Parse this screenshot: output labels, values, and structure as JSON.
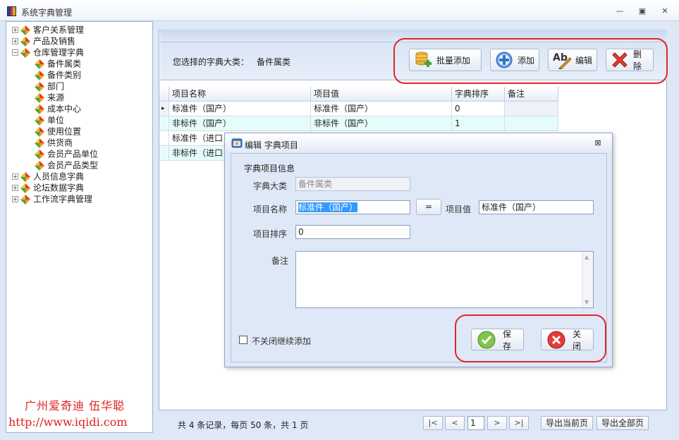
{
  "window": {
    "title": "系统字典管理"
  },
  "tree": {
    "items": [
      {
        "label": "客户关系管理",
        "expander": "⊞"
      },
      {
        "label": "产品及销售",
        "expander": "⊞"
      },
      {
        "label": "仓库管理字典",
        "expander": "⊟"
      },
      {
        "label": "备件属类"
      },
      {
        "label": "备件类别"
      },
      {
        "label": "部门"
      },
      {
        "label": "来源"
      },
      {
        "label": "成本中心"
      },
      {
        "label": "单位"
      },
      {
        "label": "使用位置"
      },
      {
        "label": "供货商"
      },
      {
        "label": "会员产品单位"
      },
      {
        "label": "会员产品类型"
      },
      {
        "label": "人员信息字典",
        "expander": "⊞"
      },
      {
        "label": "论坛数据字典",
        "expander": "⊞"
      },
      {
        "label": "工作流字典管理",
        "expander": "⊞"
      }
    ]
  },
  "watermark": {
    "line1": "广州爱奇迪 伍华聪",
    "line2": "http://www.iqidi.com"
  },
  "header": {
    "category_label": "您选择的字典大类：",
    "category_value": "备件属类"
  },
  "toolbar": {
    "batch_add": "批量添加",
    "add": "添加",
    "edit": "编辑",
    "delete": "删除"
  },
  "grid": {
    "columns": [
      "项目名称",
      "项目值",
      "字典排序",
      "备注"
    ],
    "rows": [
      [
        "标准件（国产）",
        "标准件（国产）",
        "0",
        ""
      ],
      [
        "非标件（国产）",
        "非标件（国产）",
        "1",
        ""
      ],
      [
        "标准件（进口",
        "",
        "",
        ""
      ],
      [
        "非标件（进口",
        "",
        "",
        ""
      ]
    ],
    "row_indicator": "▸"
  },
  "pager": {
    "summary": "共 4 条记录，每页 50 条，共 1 页",
    "first": "|<",
    "prev": "<",
    "page": "1",
    "next": ">",
    "last": ">|",
    "export_current": "导出当前页",
    "export_all": "导出全部页"
  },
  "dialog": {
    "title": "编辑 字典项目",
    "group_title": "字典项目信息",
    "category_label": "字典大类",
    "category_value": "备件属类",
    "name_label": "项目名称",
    "name_value": "标准件（国产）",
    "equal_button": "=",
    "value_label": "项目值",
    "value_value": "标准件（国产）",
    "sort_label": "项目排序",
    "sort_value": "0",
    "remark_label": "备注",
    "continue_label": "不关闭继续添加",
    "save": "保存",
    "close": "关闭"
  },
  "colors": {
    "highlight": "#e4242b",
    "selected_text_bg": "#3399ff",
    "alt_row": "#e6fcfc"
  }
}
